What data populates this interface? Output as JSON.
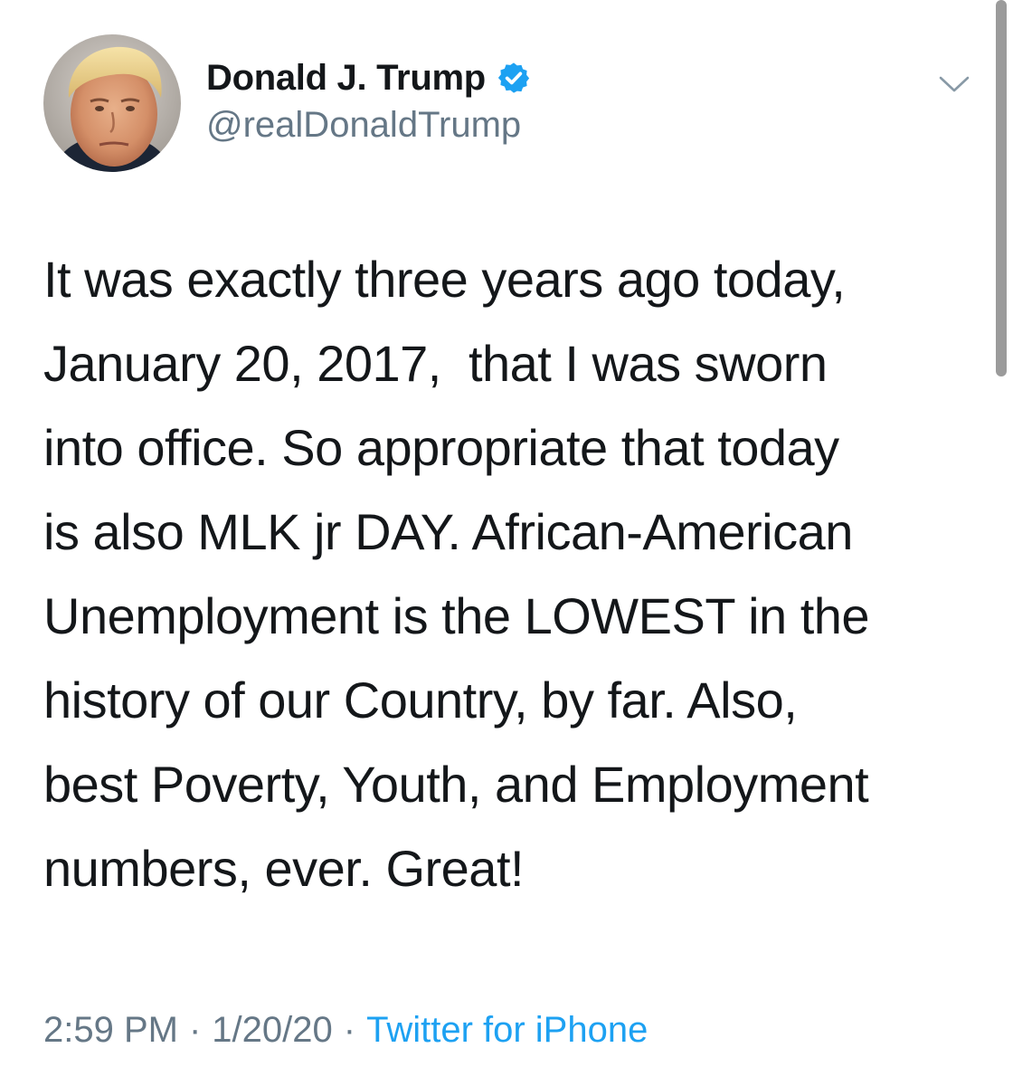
{
  "author": {
    "display_name": "Donald J. Trump",
    "handle": "@realDonaldTrump",
    "verified_icon": "verified-badge-icon"
  },
  "tweet": {
    "text": "It was exactly three years ago today,\nJanuary 20, 2017,  that I was sworn\ninto office. So appropriate that today\nis also MLK jr DAY. African-American\nUnemployment is the LOWEST in the\nhistory of our Country, by far. Also,\nbest Poverty, Youth, and Employment\nnumbers, ever. Great!"
  },
  "meta": {
    "time": "2:59 PM",
    "separator": "·",
    "date": "1/20/20",
    "source": "Twitter for iPhone"
  },
  "colors": {
    "text": "#14171a",
    "secondary": "#657786",
    "link": "#1da1f2",
    "verified": "#1da1f2"
  },
  "icons": {
    "menu": "chevron-down-icon"
  }
}
